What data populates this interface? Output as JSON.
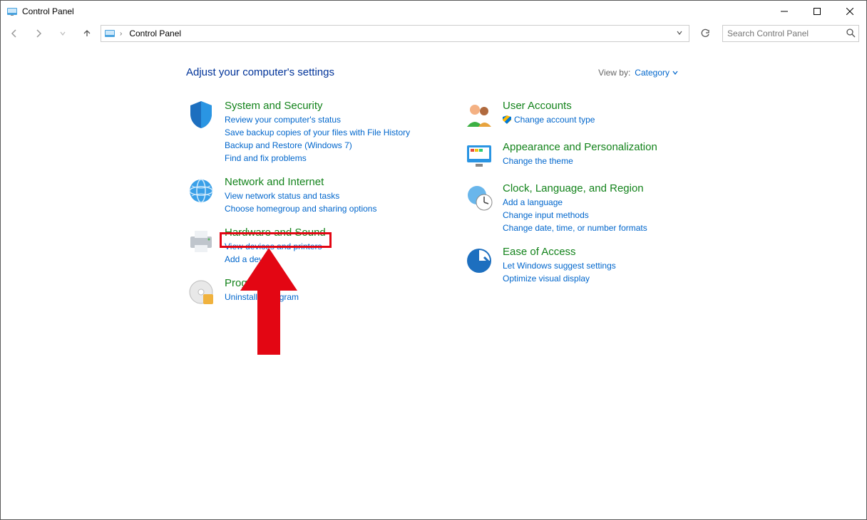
{
  "window": {
    "title": "Control Panel"
  },
  "breadcrumb": {
    "current": "Control Panel"
  },
  "search": {
    "placeholder": "Search Control Panel"
  },
  "header": {
    "heading": "Adjust your computer's settings",
    "viewby_label": "View by:",
    "viewby_value": "Category"
  },
  "left_cats": [
    {
      "title": "System and Security",
      "links": [
        "Review your computer's status",
        "Save backup copies of your files with File History",
        "Backup and Restore (Windows 7)",
        "Find and fix problems"
      ]
    },
    {
      "title": "Network and Internet",
      "links": [
        "View network status and tasks",
        "Choose homegroup and sharing options"
      ]
    },
    {
      "title": "Hardware and Sound",
      "links": [
        "View devices and printers",
        "Add a device"
      ]
    },
    {
      "title": "Programs",
      "links": [
        "Uninstall a program"
      ]
    }
  ],
  "right_cats": [
    {
      "title": "User Accounts",
      "links": [
        "Change account type"
      ],
      "shield": [
        true
      ]
    },
    {
      "title": "Appearance and Personalization",
      "links": [
        "Change the theme"
      ]
    },
    {
      "title": "Clock, Language, and Region",
      "links": [
        "Add a language",
        "Change input methods",
        "Change date, time, or number formats"
      ]
    },
    {
      "title": "Ease of Access",
      "links": [
        "Let Windows suggest settings",
        "Optimize visual display"
      ]
    }
  ],
  "highlighted_link": "View devices and printers"
}
